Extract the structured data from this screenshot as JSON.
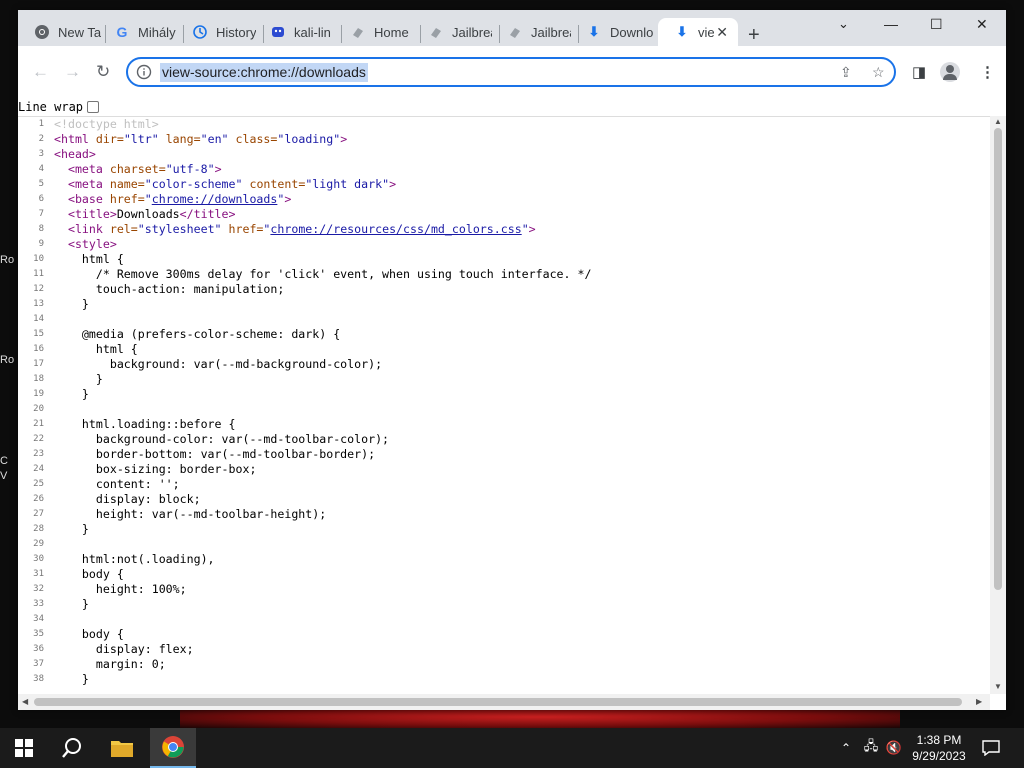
{
  "tabs": [
    {
      "label": "New Ta",
      "icon": "chrome-icon"
    },
    {
      "label": "Mihály",
      "icon": "google-icon"
    },
    {
      "label": "History",
      "icon": "history-icon"
    },
    {
      "label": "kali-lin",
      "icon": "kali-icon"
    },
    {
      "label": "Home",
      "icon": "page-icon"
    },
    {
      "label": "Jailbrea",
      "icon": "page-icon"
    },
    {
      "label": "Jailbrea",
      "icon": "page-icon"
    },
    {
      "label": "Downlo",
      "icon": "download-icon"
    },
    {
      "label": "vie",
      "icon": "download-icon"
    }
  ],
  "omnibox": {
    "url": "view-source:chrome://downloads"
  },
  "linewrap_label": "Line wrap",
  "source_lines": [
    "1",
    "2",
    "3",
    "4",
    "5",
    "6",
    "7",
    "8",
    "9",
    "10",
    "11",
    "12",
    "13",
    "14",
    "15",
    "16",
    "17",
    "18",
    "19",
    "20",
    "21",
    "22",
    "23",
    "24",
    "25",
    "26",
    "27",
    "28",
    "29",
    "30",
    "31",
    "32",
    "33",
    "34",
    "35",
    "36",
    "37",
    "38"
  ],
  "source": {
    "l1": "<!doctype html>",
    "l2a": "<html ",
    "l2b": "dir=",
    "l2c": "\"ltr\"",
    "l2d": " lang=",
    "l2e": "\"en\"",
    "l2f": " class=",
    "l2g": "\"loading\"",
    "l2h": ">",
    "l3": "<head>",
    "l4a": "  <meta ",
    "l4b": "charset=",
    "l4c": "\"utf-8\"",
    "l4d": ">",
    "l5a": "  <meta ",
    "l5b": "name=",
    "l5c": "\"color-scheme\"",
    "l5d": " content=",
    "l5e": "\"light dark\"",
    "l5f": ">",
    "l6a": "  <base ",
    "l6b": "href=",
    "l6c": "\"",
    "l6d": "chrome://downloads",
    "l6e": "\"",
    "l6f": ">",
    "l7a": "  <title>",
    "l7b": "Downloads",
    "l7c": "</title>",
    "l8a": "  <link ",
    "l8b": "rel=",
    "l8c": "\"stylesheet\"",
    "l8d": " href=",
    "l8e": "\"",
    "l8f": "chrome://resources/css/md_colors.css",
    "l8g": "\"",
    "l8h": ">",
    "l9": "  <style>",
    "l10": "    html {",
    "l11": "      /* Remove 300ms delay for 'click' event, when using touch interface. */",
    "l12": "      touch-action: manipulation;",
    "l13": "    }",
    "l14": "",
    "l15": "    @media (prefers-color-scheme: dark) {",
    "l16": "      html {",
    "l17": "        background: var(--md-background-color);",
    "l18": "      }",
    "l19": "    }",
    "l20": "",
    "l21": "    html.loading::before {",
    "l22": "      background-color: var(--md-toolbar-color);",
    "l23": "      border-bottom: var(--md-toolbar-border);",
    "l24": "      box-sizing: border-box;",
    "l25": "      content: '';",
    "l26": "      display: block;",
    "l27": "      height: var(--md-toolbar-height);",
    "l28": "    }",
    "l29": "",
    "l30": "    html:not(.loading),",
    "l31": "    body {",
    "l32": "      height: 100%;",
    "l33": "    }",
    "l34": "",
    "l35": "    body {",
    "l36": "      display: flex;",
    "l37": "      margin: 0;",
    "l38": "    }"
  },
  "desktop_icons": [
    "Ro",
    "Ro",
    "C",
    "V"
  ],
  "taskbar": {
    "time": "1:38 PM",
    "date": "9/29/2023"
  },
  "colors": {
    "accent": "#1a73e8",
    "selection": "#c2d7f5",
    "tag": "#881280",
    "attr": "#994500",
    "value": "#1a1aa6"
  }
}
